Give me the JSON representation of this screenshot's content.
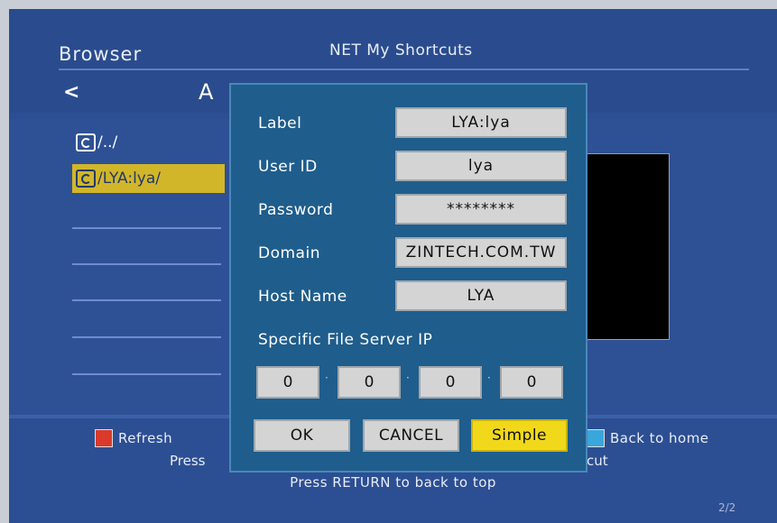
{
  "header": {
    "app_title": "Browser",
    "title": "NET  My Shortcuts",
    "path_initial": "A"
  },
  "list": {
    "items": [
      {
        "label": "/../",
        "selected": false
      },
      {
        "label": "/LYA:lya/",
        "selected": true
      }
    ],
    "page_indicator": "2/2"
  },
  "dialog": {
    "fields": [
      {
        "label": "Label",
        "value": "LYA:lya"
      },
      {
        "label": "User ID",
        "value": "lya"
      },
      {
        "label": "Password",
        "value": "********"
      },
      {
        "label": "Domain",
        "value": "ZINTECH.COM.TW"
      },
      {
        "label": "Host Name",
        "value": "LYA"
      }
    ],
    "ip_label": "Specific File Server IP",
    "ip": [
      "0",
      "0",
      "0",
      "0"
    ],
    "buttons": {
      "ok": "OK",
      "cancel": "CANCEL",
      "simple": "Simple"
    }
  },
  "footer": {
    "refresh": "Refresh",
    "back_home": "Back to home",
    "press_left": "Press",
    "press_right": "rtcut",
    "press_return": "Press RETURN to back to top"
  },
  "colors": {
    "background": "#2c4f93",
    "dialog": "#1f5d8c",
    "selected_item": "#d2b629",
    "simple_button": "#f2d81b",
    "red_key": "#d93a2b",
    "blue_key": "#39a7dc"
  }
}
